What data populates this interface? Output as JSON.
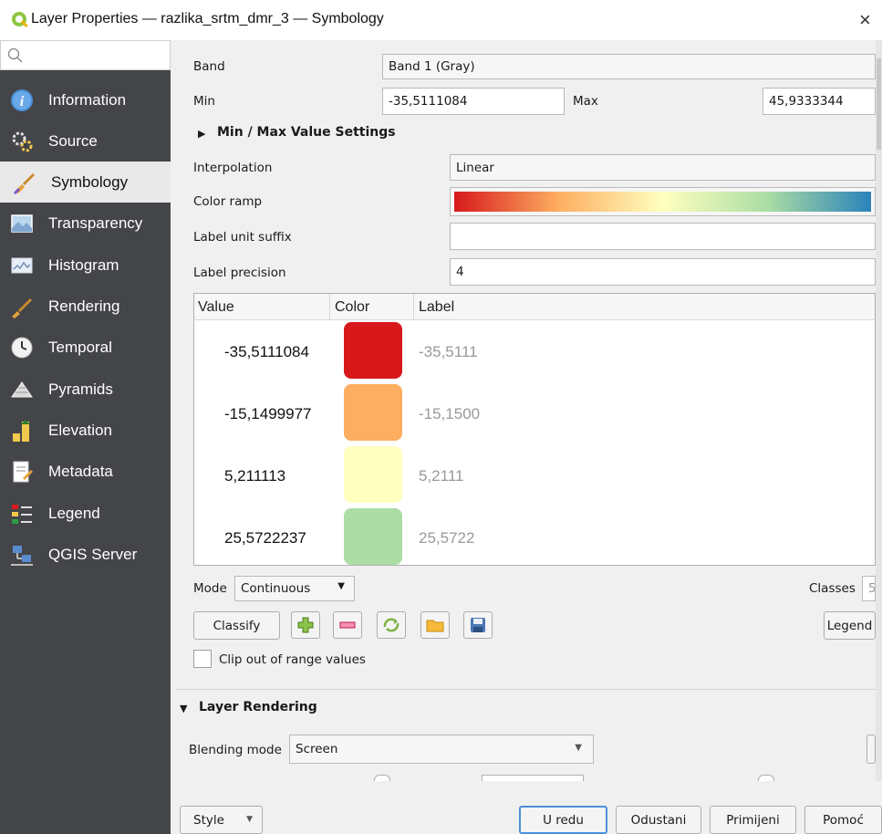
{
  "window": {
    "title": "Layer Properties — razlika_srtm_dmr_3 — Symbology",
    "close_glyph": "×"
  },
  "sidebar": {
    "search_placeholder": "",
    "items": [
      {
        "label": "Information",
        "icon": "information-icon"
      },
      {
        "label": "Source",
        "icon": "source-icon"
      },
      {
        "label": "Symbology",
        "icon": "symbology-icon",
        "active": true
      },
      {
        "label": "Transparency",
        "icon": "transparency-icon"
      },
      {
        "label": "Histogram",
        "icon": "histogram-icon"
      },
      {
        "label": "Rendering",
        "icon": "rendering-icon"
      },
      {
        "label": "Temporal",
        "icon": "temporal-icon"
      },
      {
        "label": "Pyramids",
        "icon": "pyramids-icon"
      },
      {
        "label": "Elevation",
        "icon": "elevation-icon"
      },
      {
        "label": "Metadata",
        "icon": "metadata-icon"
      },
      {
        "label": "Legend",
        "icon": "legend-icon"
      },
      {
        "label": "QGIS Server",
        "icon": "qgis-server-icon"
      }
    ]
  },
  "symbology": {
    "band_label": "Band",
    "band_value": "Band 1 (Gray)",
    "min_label": "Min",
    "min_value": "-35,5111084",
    "max_label": "Max",
    "max_value": "45,9333344",
    "minmax_settings": "Min / Max Value Settings",
    "interpolation_label": "Interpolation",
    "interpolation_value": "Linear",
    "color_ramp_label": "Color ramp",
    "unit_suffix_label": "Label unit suffix",
    "unit_suffix_value": "",
    "precision_label": "Label precision",
    "precision_value": "4",
    "table": {
      "headers": [
        "Value",
        "Color",
        "Label"
      ],
      "rows": [
        {
          "value": "-35,5111084",
          "color": "#d7191c",
          "label": "-35,5111"
        },
        {
          "value": "-15,1499977",
          "color": "#fdae61",
          "label": "-15,1500"
        },
        {
          "value": "5,211113",
          "color": "#ffffc0",
          "label": "5,2111"
        },
        {
          "value": "25,5722237",
          "color": "#abdda4",
          "label": "25,5722"
        }
      ]
    },
    "mode_label": "Mode",
    "mode_value": "Continuous",
    "classes_label": "Classes",
    "classes_value": "5",
    "classify_label": "Classify",
    "legend_label": "Legend",
    "clip_label": "Clip out of range values",
    "clip_checked": false
  },
  "layer_rendering": {
    "section_label": "Layer Rendering",
    "blending_label": "Blending mode",
    "blending_value": "Screen"
  },
  "footer": {
    "style_label": "Style",
    "ok_label": "U redu",
    "cancel_label": "Odustani",
    "apply_label": "Primijeni",
    "help_label": "Pomoć"
  },
  "colors": {
    "sidebar_bg": "#444549",
    "ramp": [
      "#d7191c",
      "#fdae61",
      "#ffffbf",
      "#abdda4",
      "#2b83ba"
    ]
  }
}
